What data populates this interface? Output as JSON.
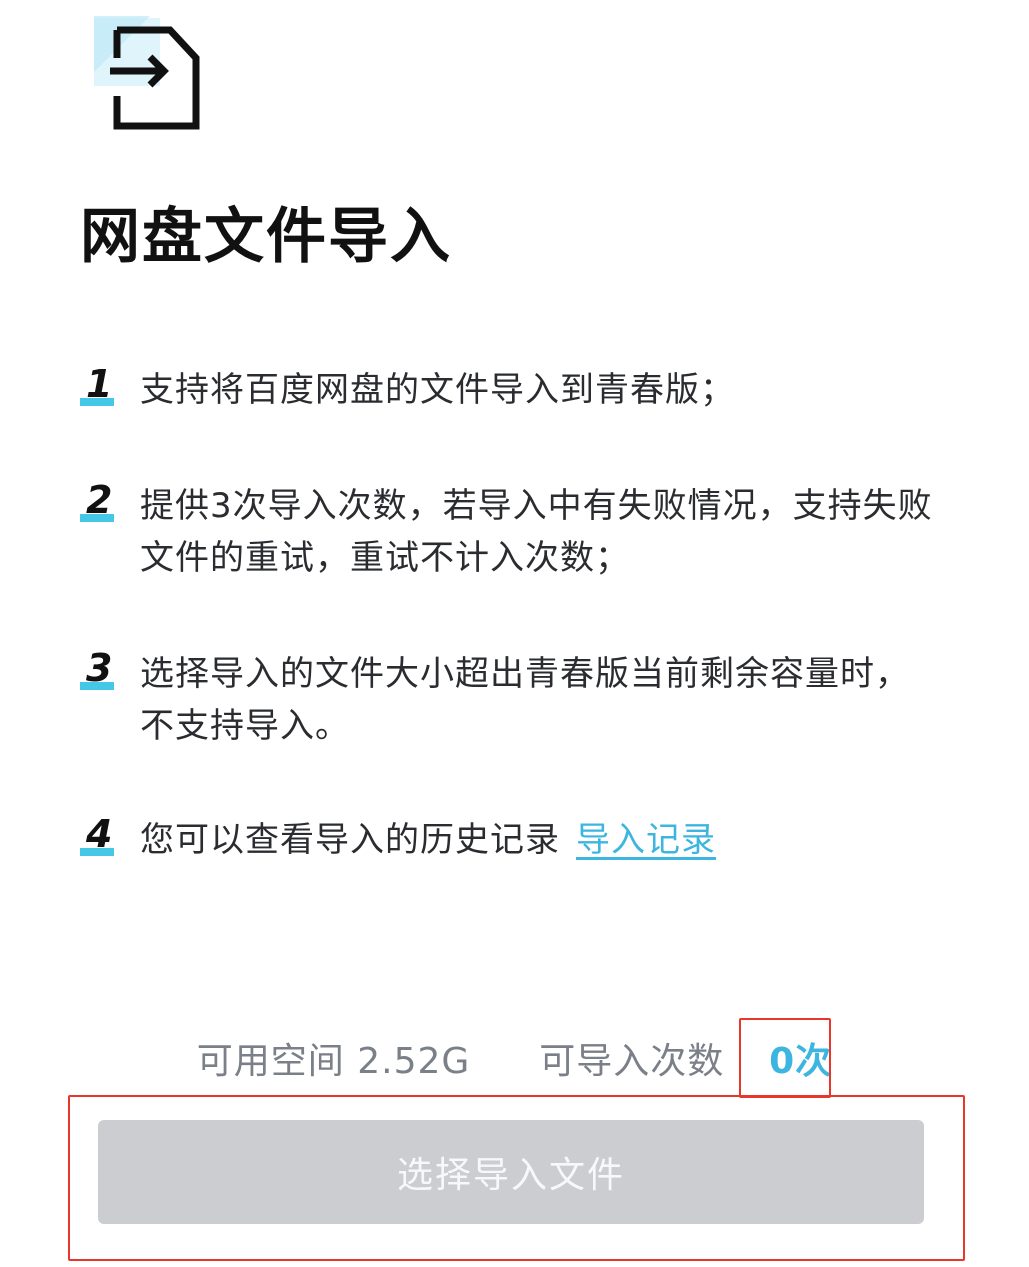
{
  "header": {
    "icon": "file-import-icon",
    "title": "网盘文件导入"
  },
  "steps": [
    {
      "num": "1",
      "text": "支持将百度网盘的文件导入到青春版；"
    },
    {
      "num": "2",
      "text": "提供3次导入次数，若导入中有失败情况，支持失败文件的重试，重试不计入次数；"
    },
    {
      "num": "3",
      "text": "选择导入的文件大小超出青春版当前剩余容量时，不支持导入。"
    },
    {
      "num": "4",
      "text": "您可以查看导入的历史记录",
      "link": "导入记录"
    }
  ],
  "footer": {
    "space_label": "可用空间 2.52G",
    "count_label": "可导入次数",
    "count_value": "0次"
  },
  "button": {
    "label": "选择导入文件"
  },
  "colors": {
    "accent": "#3cb6e0",
    "highlight": "#e8362a",
    "button_disabled": "#cbcdd1"
  }
}
